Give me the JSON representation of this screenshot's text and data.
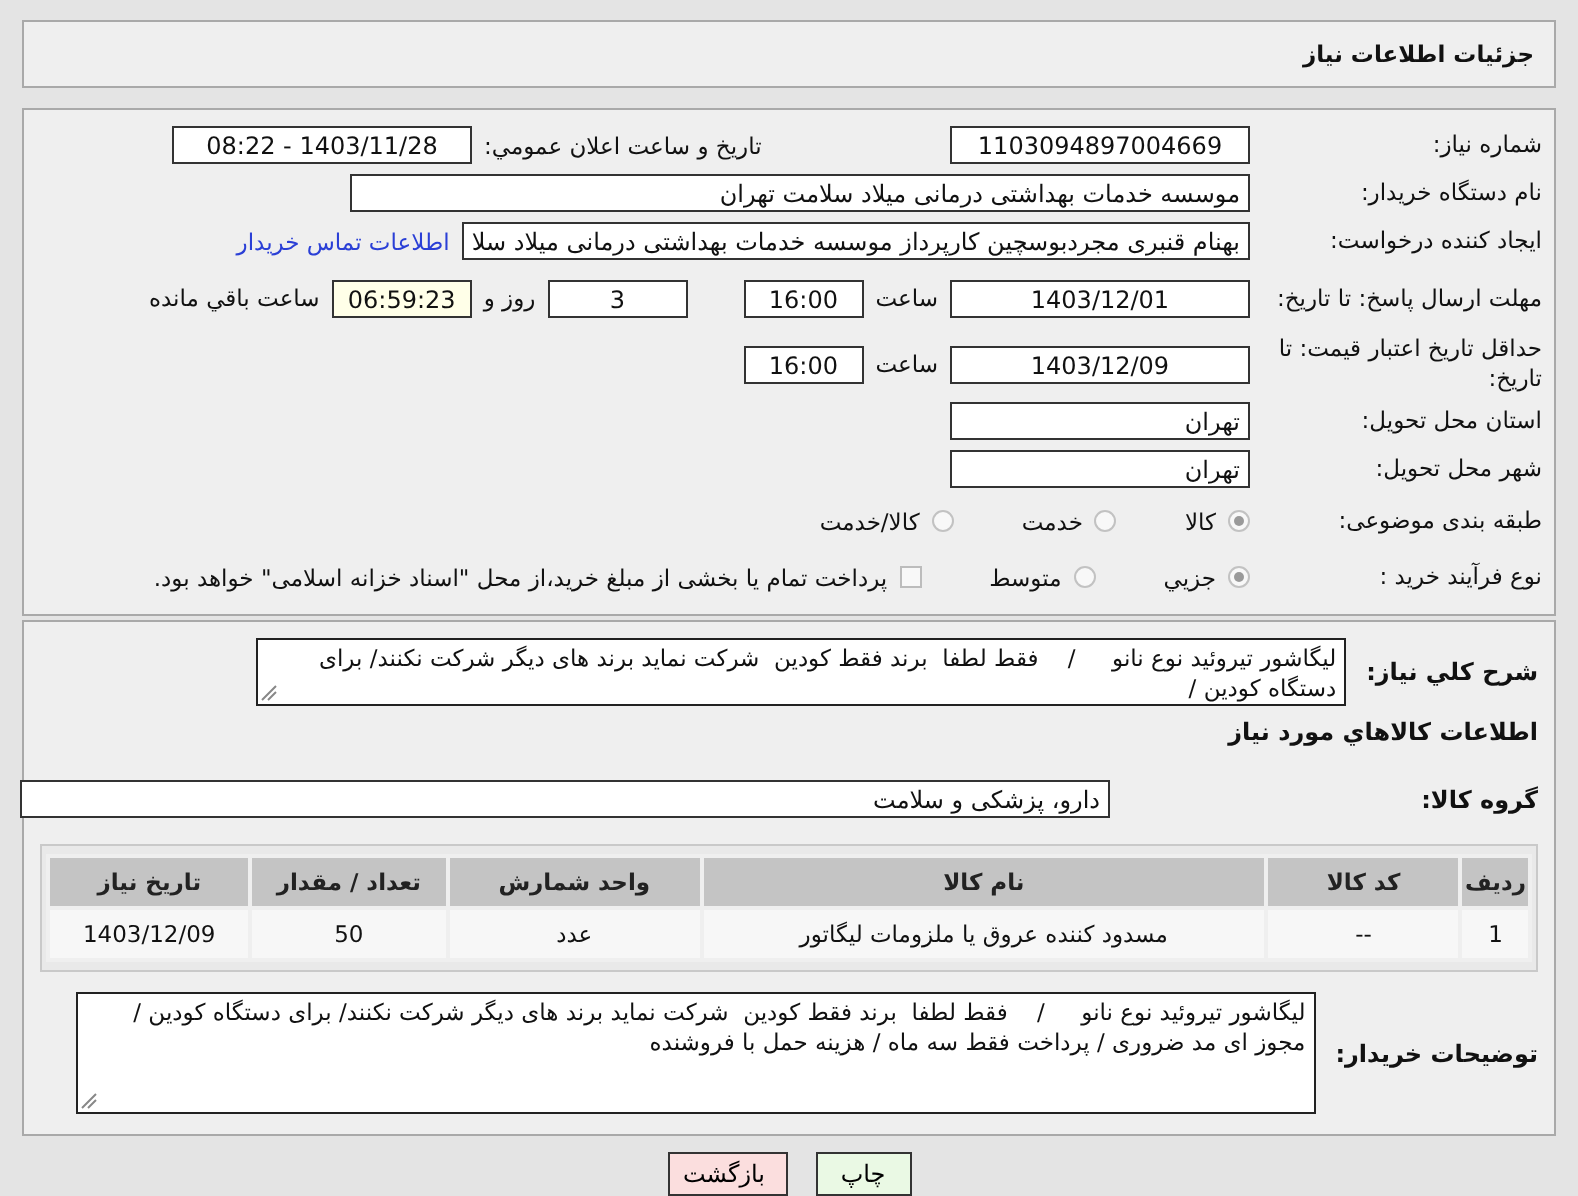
{
  "page_title": "جزئیات اطلاعات نیاز",
  "need_number": {
    "label": "شماره نیاز:",
    "value": "1103094897004669"
  },
  "announce": {
    "label": "تاریخ و ساعت اعلان عمومي:",
    "value": "1403/11/28 - 08:22"
  },
  "buyer": {
    "label": "نام دستگاه خریدار:",
    "value": "موسسه خدمات بهداشتی درمانی میلاد سلامت تهران"
  },
  "creator": {
    "label": "ایجاد کننده درخواست:",
    "value": "بهنام قنبری مجردبوسچین کارپرداز موسسه خدمات بهداشتی درمانی میلاد سلا",
    "contact_link": "اطلاعات تماس خریدار"
  },
  "reply_deadline": {
    "label": "مهلت ارسال پاسخ: تا تاریخ:",
    "date": "1403/12/01",
    "time_label": "ساعت",
    "time": "16:00",
    "days": "3",
    "days_label": "روز و",
    "remaining": "06:59:23",
    "remaining_label": "ساعت باقي مانده"
  },
  "price_validity": {
    "label": "حداقل تاریخ اعتبار قیمت: تا تاریخ:",
    "date": "1403/12/09",
    "time_label": "ساعت",
    "time": "16:00"
  },
  "province": {
    "label": "استان محل تحویل:",
    "value": "تهران"
  },
  "city": {
    "label": "شهر محل تحویل:",
    "value": "تهران"
  },
  "category": {
    "label": "طبقه بندی موضوعی:",
    "options": [
      {
        "label": "کالا",
        "selected": true
      },
      {
        "label": "خدمت",
        "selected": false
      },
      {
        "label": "کالا/خدمت",
        "selected": false
      }
    ]
  },
  "purchase_type": {
    "label": "نوع فرآیند خرید :",
    "options": [
      {
        "label": "جزیي",
        "selected": true
      },
      {
        "label": "متوسط",
        "selected": false
      }
    ],
    "payment_checkbox": {
      "label": "پرداخت تمام یا بخشی از مبلغ خرید،از محل \"اسناد خزانه اسلامی\" خواهد بود.",
      "checked": false
    }
  },
  "description": {
    "label": "شرح کلي نياز:",
    "text": "لیگاشور تیروئید نوع نانو     /    فقط لطفا  برند فقط کودین  شرکت نماید برند های دیگر شرکت نکنند/ برای دستگاه کودین /"
  },
  "items_heading": "اطلاعات کالاهاي مورد نياز",
  "goods_group": {
    "label": "گروه کالا:",
    "value": "دارو، پزشکی و سلامت"
  },
  "table": {
    "columns": [
      "ردیف",
      "کد کالا",
      "نام کالا",
      "واحد شمارش",
      "تعداد / مقدار",
      "تاریخ نیاز"
    ],
    "rows": [
      [
        "1",
        "--",
        "مسدود کننده عروق یا ملزومات لیگاتور",
        "عدد",
        "50",
        "1403/12/09"
      ]
    ]
  },
  "buyer_notes": {
    "label": "توضیحات خریدار:",
    "text": "لیگاشور تیروئید نوع نانو     /    فقط لطفا  برند فقط کودین  شرکت نماید برند های دیگر شرکت نکنند/ برای دستگاه کودین / مجوز ای مد ضروری / پرداخت فقط سه ماه / هزینه حمل با فروشنده"
  },
  "buttons": [
    {
      "label": "چاپ",
      "kind": "print"
    },
    {
      "label": "بازگشت",
      "kind": "back"
    }
  ]
}
